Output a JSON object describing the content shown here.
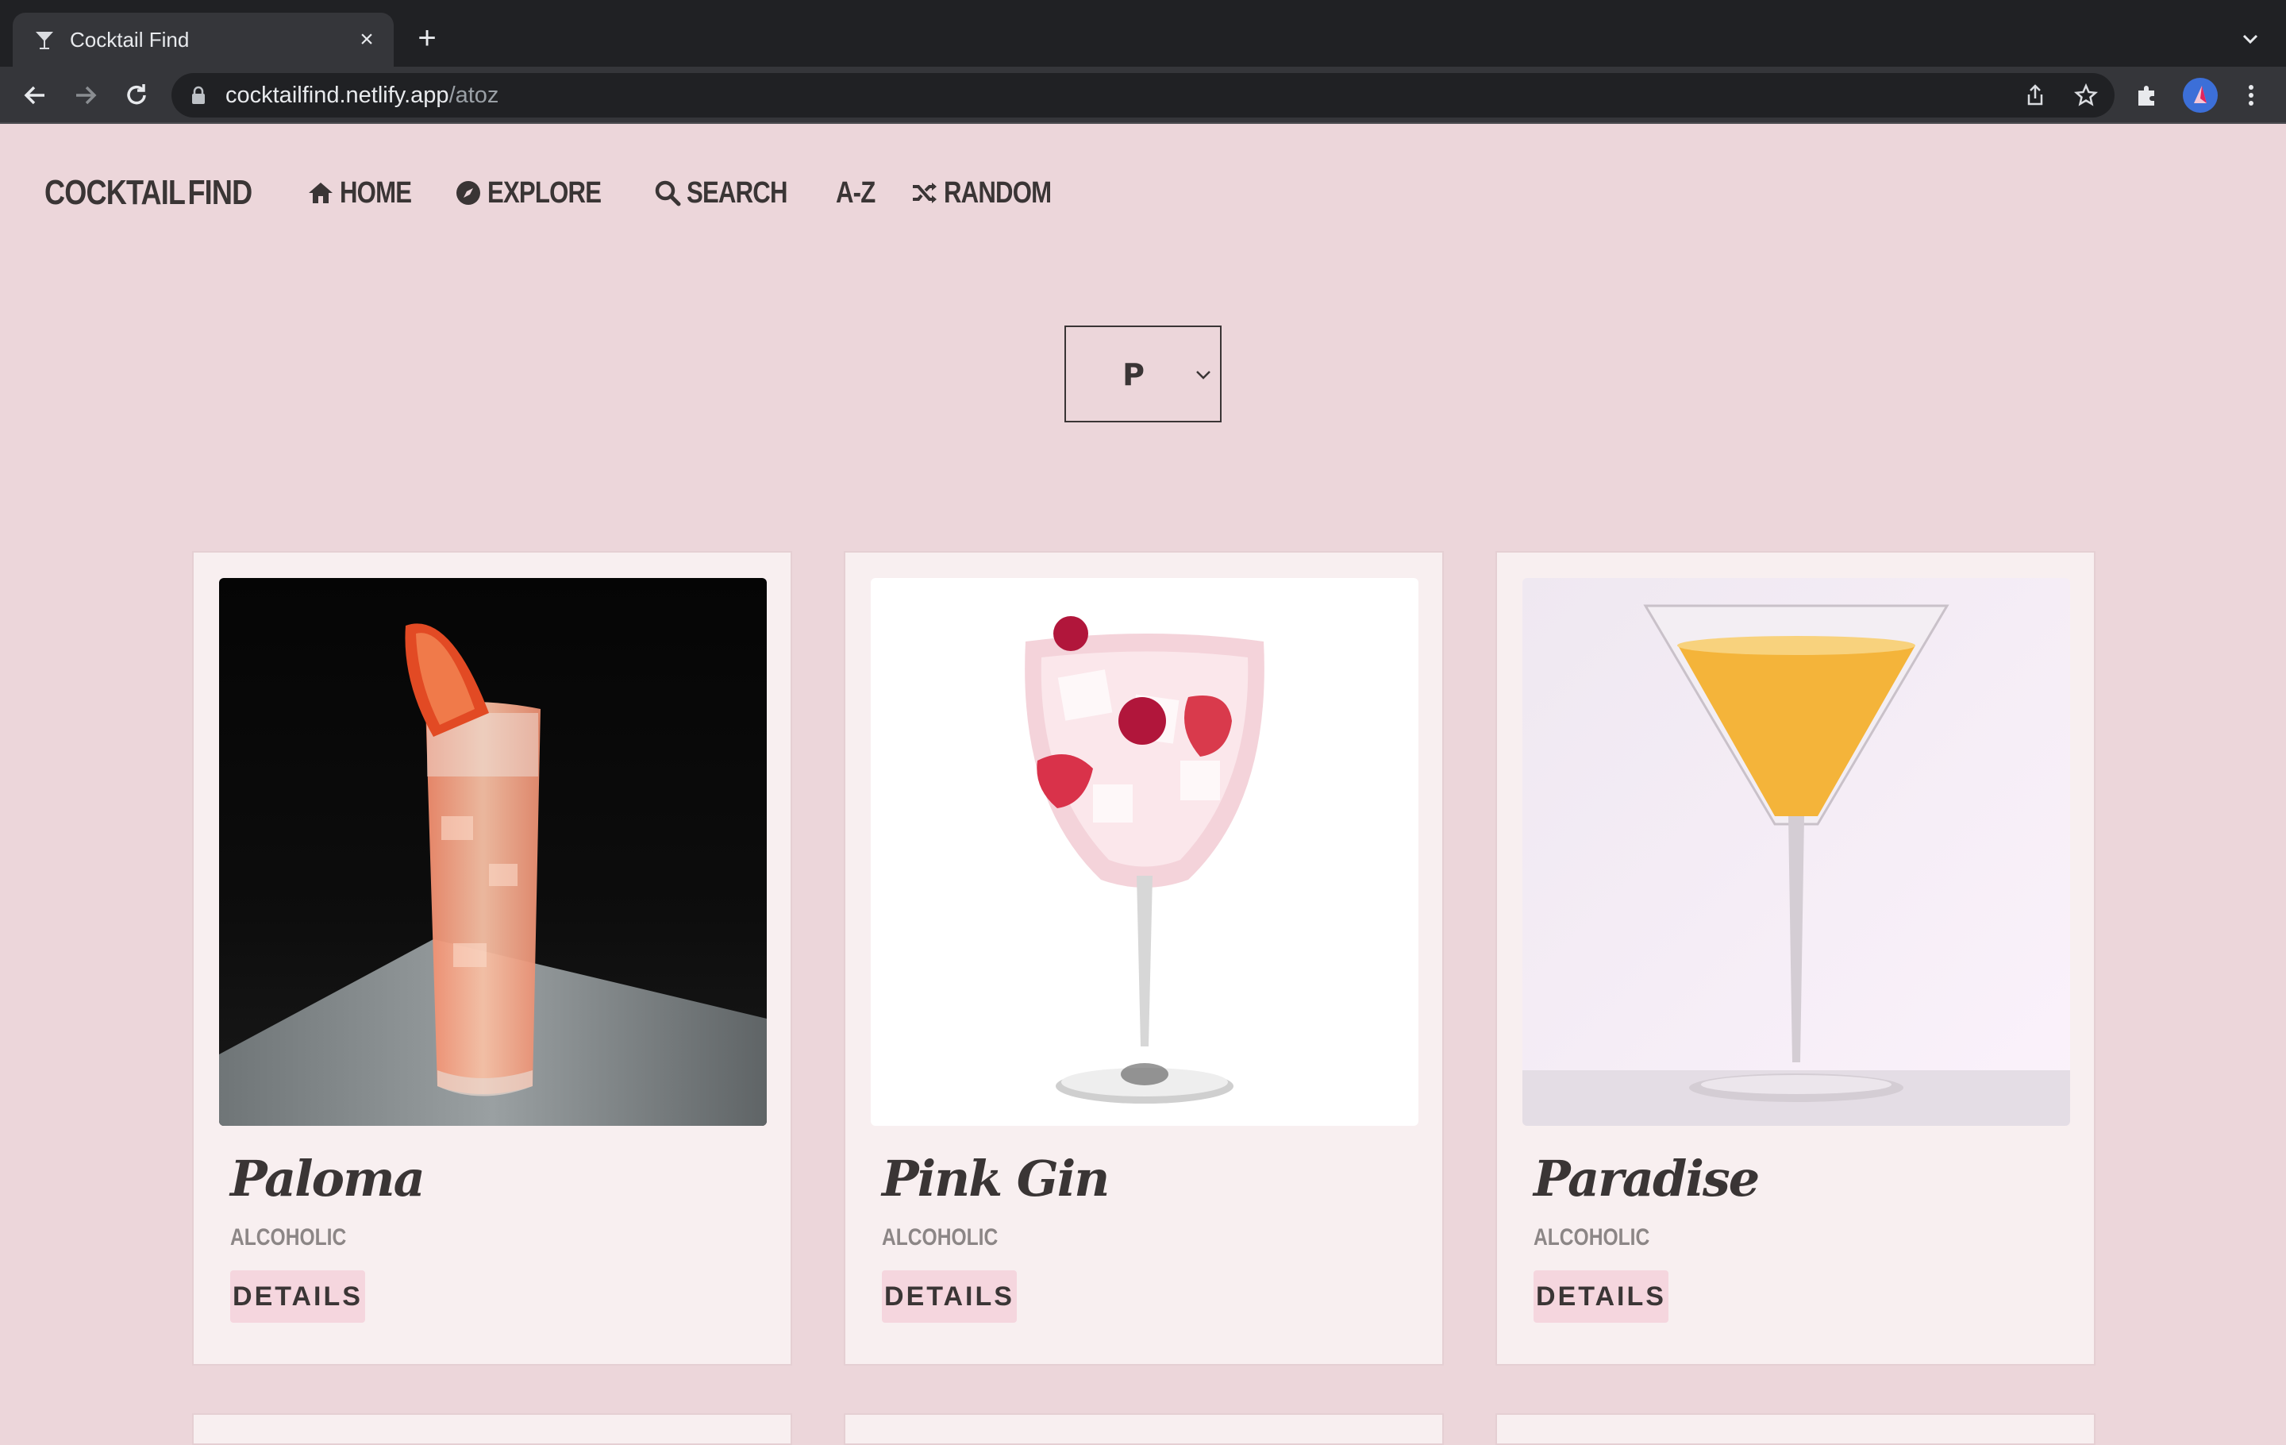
{
  "browser": {
    "tab_title": "Cocktail Find",
    "url_host": "cocktailfind.netlify.app",
    "url_path": "/atoz"
  },
  "nav": {
    "logo_left": "COCKTAIL",
    "logo_right": "FIND",
    "links": [
      {
        "label": "HOME",
        "icon": "home-icon"
      },
      {
        "label": "EXPLORE",
        "icon": "compass-icon"
      },
      {
        "label": "SEARCH",
        "icon": "search-icon"
      },
      {
        "label": "A-Z",
        "icon": ""
      },
      {
        "label": "RANDOM",
        "icon": "shuffle-icon"
      }
    ]
  },
  "letter_select": {
    "value": "P"
  },
  "cards": [
    {
      "title": "Paloma",
      "type": "ALCOHOLIC",
      "button": "DETAILS"
    },
    {
      "title": "Pink Gin",
      "type": "ALCOHOLIC",
      "button": "DETAILS"
    },
    {
      "title": "Paradise",
      "type": "ALCOHOLIC",
      "button": "DETAILS"
    }
  ],
  "colors": {
    "page_bg": "#ecd6da",
    "card_bg": "#f8eff0",
    "accent": "#e6419a",
    "text": "#3a3535"
  }
}
